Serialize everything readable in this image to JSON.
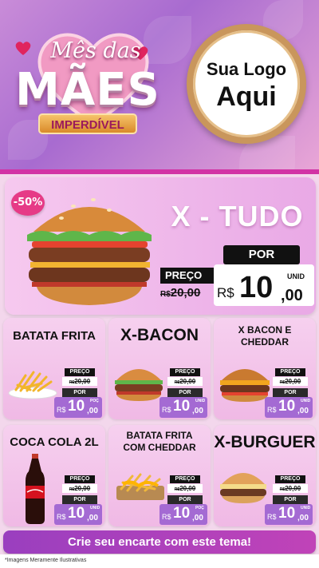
{
  "header": {
    "title_line1": "Mês das",
    "title_line2": "MÃES",
    "title_line3": "IMPERDÍVEL",
    "logo_line1": "Sua Logo",
    "logo_line2": "Aqui"
  },
  "hero": {
    "title": "X - TUDO",
    "discount": "-50%",
    "preco_label": "PREÇO",
    "old_currency": "R$",
    "old_value": "20,00",
    "por_label": "POR",
    "new_currency": "R$",
    "new_int": "10",
    "new_dec": ",00",
    "unit": "UNID"
  },
  "products": [
    {
      "name": "BATATA FRITA",
      "preco": "PREÇO",
      "old_cur": "R$",
      "old": "20,00",
      "por": "POR",
      "cur": "R$",
      "int": "10",
      "dec": ",00",
      "unit": "POÇ"
    },
    {
      "name": "X-BACON",
      "preco": "PREÇO",
      "old_cur": "R$",
      "old": "20,00",
      "por": "POR",
      "cur": "R$",
      "int": "10",
      "dec": ",00",
      "unit": "UNID"
    },
    {
      "name": "X BACON E CHEDDAR",
      "preco": "PREÇO",
      "old_cur": "R$",
      "old": "20,00",
      "por": "POR",
      "cur": "R$",
      "int": "10",
      "dec": ",00",
      "unit": "UNID"
    },
    {
      "name": "COCA COLA 2L",
      "preco": "PREÇO",
      "old_cur": "R$",
      "old": "20,00",
      "por": "POR",
      "cur": "R$",
      "int": "10",
      "dec": ",00",
      "unit": "UNID"
    },
    {
      "name": "BATATA FRITA COM CHEDDAR",
      "preco": "PREÇO",
      "old_cur": "R$",
      "old": "20,00",
      "por": "POR",
      "cur": "R$",
      "int": "10",
      "dec": ",00",
      "unit": "POÇ"
    },
    {
      "name": "X-BURGUER",
      "preco": "PREÇO",
      "old_cur": "R$",
      "old": "20,00",
      "por": "POR",
      "cur": "R$",
      "int": "10",
      "dec": ",00",
      "unit": "UNID"
    }
  ],
  "footer": {
    "cta": "Crie seu encarte com este tema!",
    "note": "*Imagens Meramente Ilustrativas"
  },
  "colors": {
    "accent": "#d233a5",
    "price_purple": "#a46ad3",
    "cta": "#9a3fbf"
  }
}
